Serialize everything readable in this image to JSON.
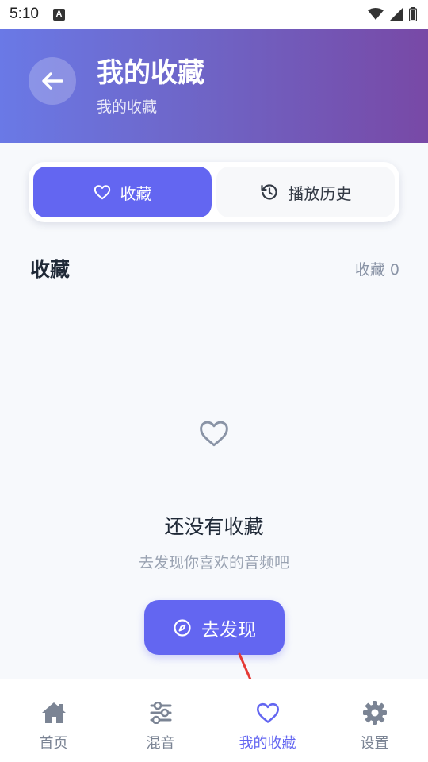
{
  "status_bar": {
    "time": "5:10",
    "notification_letter": "A",
    "icons": [
      "wifi-icon",
      "signal-icon",
      "battery-icon"
    ]
  },
  "header": {
    "title": "我的收藏",
    "subtitle": "我的收藏",
    "back_icon": "arrow-left-icon"
  },
  "tabs": [
    {
      "label": "收藏",
      "icon": "heart-icon",
      "active": true
    },
    {
      "label": "播放历史",
      "icon": "history-icon",
      "active": false
    }
  ],
  "section": {
    "title": "收藏",
    "count_label": "收藏 0"
  },
  "empty_state": {
    "icon": "heart-outline-icon",
    "title": "还没有收藏",
    "subtitle": "去发现你喜欢的音频吧",
    "button_label": "去发现",
    "button_icon": "compass-icon"
  },
  "bottom_nav": [
    {
      "label": "首页",
      "icon": "home-icon",
      "active": false
    },
    {
      "label": "混音",
      "icon": "sliders-icon",
      "active": false
    },
    {
      "label": "我的收藏",
      "icon": "heart-icon",
      "active": true
    },
    {
      "label": "设置",
      "icon": "gear-icon",
      "active": false
    }
  ],
  "colors": {
    "accent": "#6366f1",
    "header_gradient_start": "#6a79e6",
    "header_gradient_end": "#7849a6",
    "annotation_arrow": "#e53935"
  }
}
